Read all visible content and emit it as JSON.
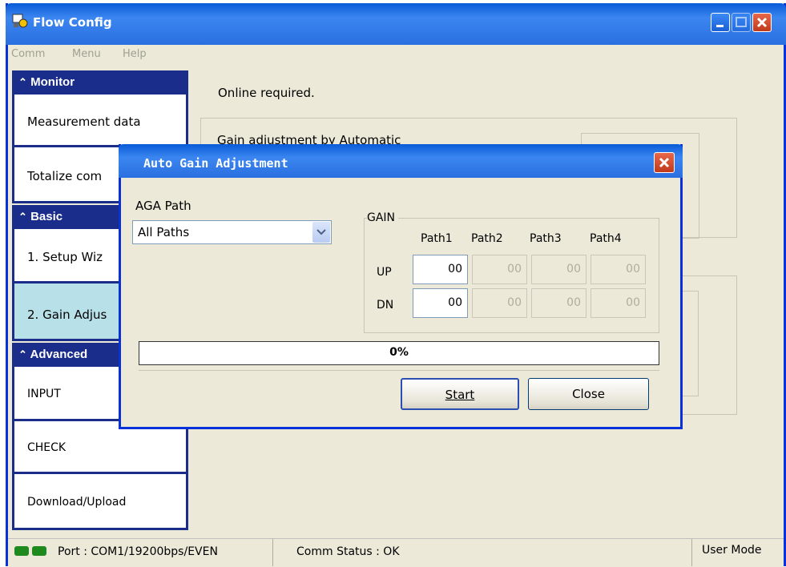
{
  "window": {
    "title": "Flow Config"
  },
  "menubar": {
    "comm": "Comm",
    "menu": "Menu",
    "help": "Help"
  },
  "sidebar": {
    "monitor_header": "Monitor",
    "basic_header": "Basic",
    "advanced_header": "Advanced",
    "collapse_glyph": "⌃",
    "items": [
      "Measurement data",
      "Totalize com",
      "1. Setup Wiz",
      "2. Gain Adjus",
      "INPUT",
      "CHECK",
      "Download/Upload"
    ]
  },
  "main": {
    "online_message": "Online required.",
    "group_label": "Gain adjustment by Automatic"
  },
  "dialog": {
    "title": "Auto Gain Adjustment",
    "path_label": "AGA Path",
    "path_value": "All Paths",
    "gain_label": "GAIN",
    "columns": [
      "Path1",
      "Path2",
      "Path3",
      "Path4"
    ],
    "rows": [
      {
        "label": "UP",
        "values": [
          "00",
          "00",
          "00",
          "00"
        ]
      },
      {
        "label": "DN",
        "values": [
          "00",
          "00",
          "00",
          "00"
        ]
      }
    ],
    "progress_text": "0%",
    "progress": 0,
    "start_label": "Start",
    "close_label": "Close"
  },
  "statusbar": {
    "port": "Port : COM1/19200bps/EVEN",
    "comm_status": "Comm Status : OK",
    "mode": "User Mode"
  },
  "colors": {
    "titlebar": "#0a5bd8",
    "sidebar_header": "#1a2d8a",
    "selected_item": "#b8e0e8",
    "status_led": "#1e8a1e"
  }
}
